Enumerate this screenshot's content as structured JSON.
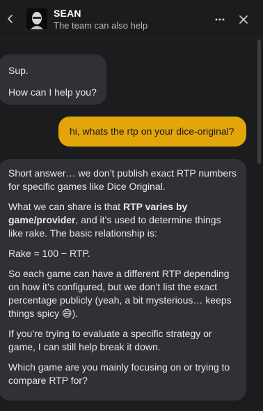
{
  "header": {
    "back_icon": "chevron-left-icon",
    "name": "SEAN",
    "subtitle": "The team can also help",
    "more_icon": "ellipsis-icon",
    "close_icon": "close-icon"
  },
  "messages": [
    {
      "role": "agent",
      "lines": [
        "Sup.",
        "How can I help you?"
      ]
    },
    {
      "role": "user",
      "text": "hi, whats the rtp on your dice-original?"
    },
    {
      "role": "agent",
      "paragraphs": {
        "p1": "Short answer… we don’t publish exact RTP numbers for specific games like Dice Original.",
        "p2_before": "What we can share is that ",
        "p2_bold": "RTP varies by game/provider",
        "p2_after": ", and it’s used to determine things like rake. The basic relationship is:",
        "p3": "Rake = 100 − RTP.",
        "p4": "So each game can have a different RTP depending on how it’s configured, but we don’t list the exact percentage publicly (yeah, a bit mysterious… keeps things spicy 😄).",
        "p5": "If you’re trying to evaluate a specific strategy or game, I can still help break it down.",
        "p6": "Which game are you mainly focusing on or trying to compare RTP for?"
      }
    }
  ],
  "colors": {
    "background": "#1b1c1e",
    "agent_bubble": "#303134",
    "user_bubble": "#e2a50a"
  }
}
